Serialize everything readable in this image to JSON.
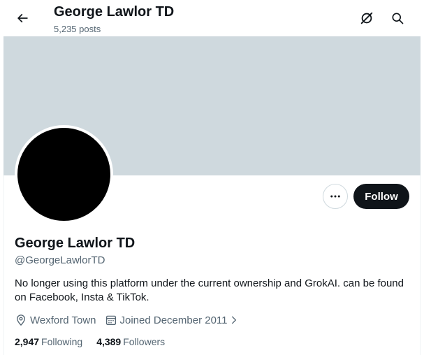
{
  "header": {
    "title": "George Lawlor TD",
    "post_count": "5,235 posts"
  },
  "icons": {
    "back": "arrow-left-icon",
    "grok": "grok-icon",
    "search": "search-icon",
    "more": "more-horizontal-icon",
    "location": "location-pin-icon",
    "calendar": "calendar-icon",
    "chevron": "chevron-right-icon"
  },
  "colors": {
    "banner": "#cfd9de",
    "avatar": "#000000",
    "follow_button": "#0f1419",
    "secondary_text": "#536471"
  },
  "profile": {
    "display_name": "George Lawlor TD",
    "handle": "@GeorgeLawlorTD",
    "bio": "No longer using this platform under the current ownership and GrokAI. can be found on Facebook, Insta & TikTok.",
    "location": "Wexford Town",
    "joined": "Joined December 2011"
  },
  "actions": {
    "follow_label": "Follow"
  },
  "stats": {
    "following_count": "2,947",
    "following_label": "Following",
    "followers_count": "4,389",
    "followers_label": "Followers"
  }
}
